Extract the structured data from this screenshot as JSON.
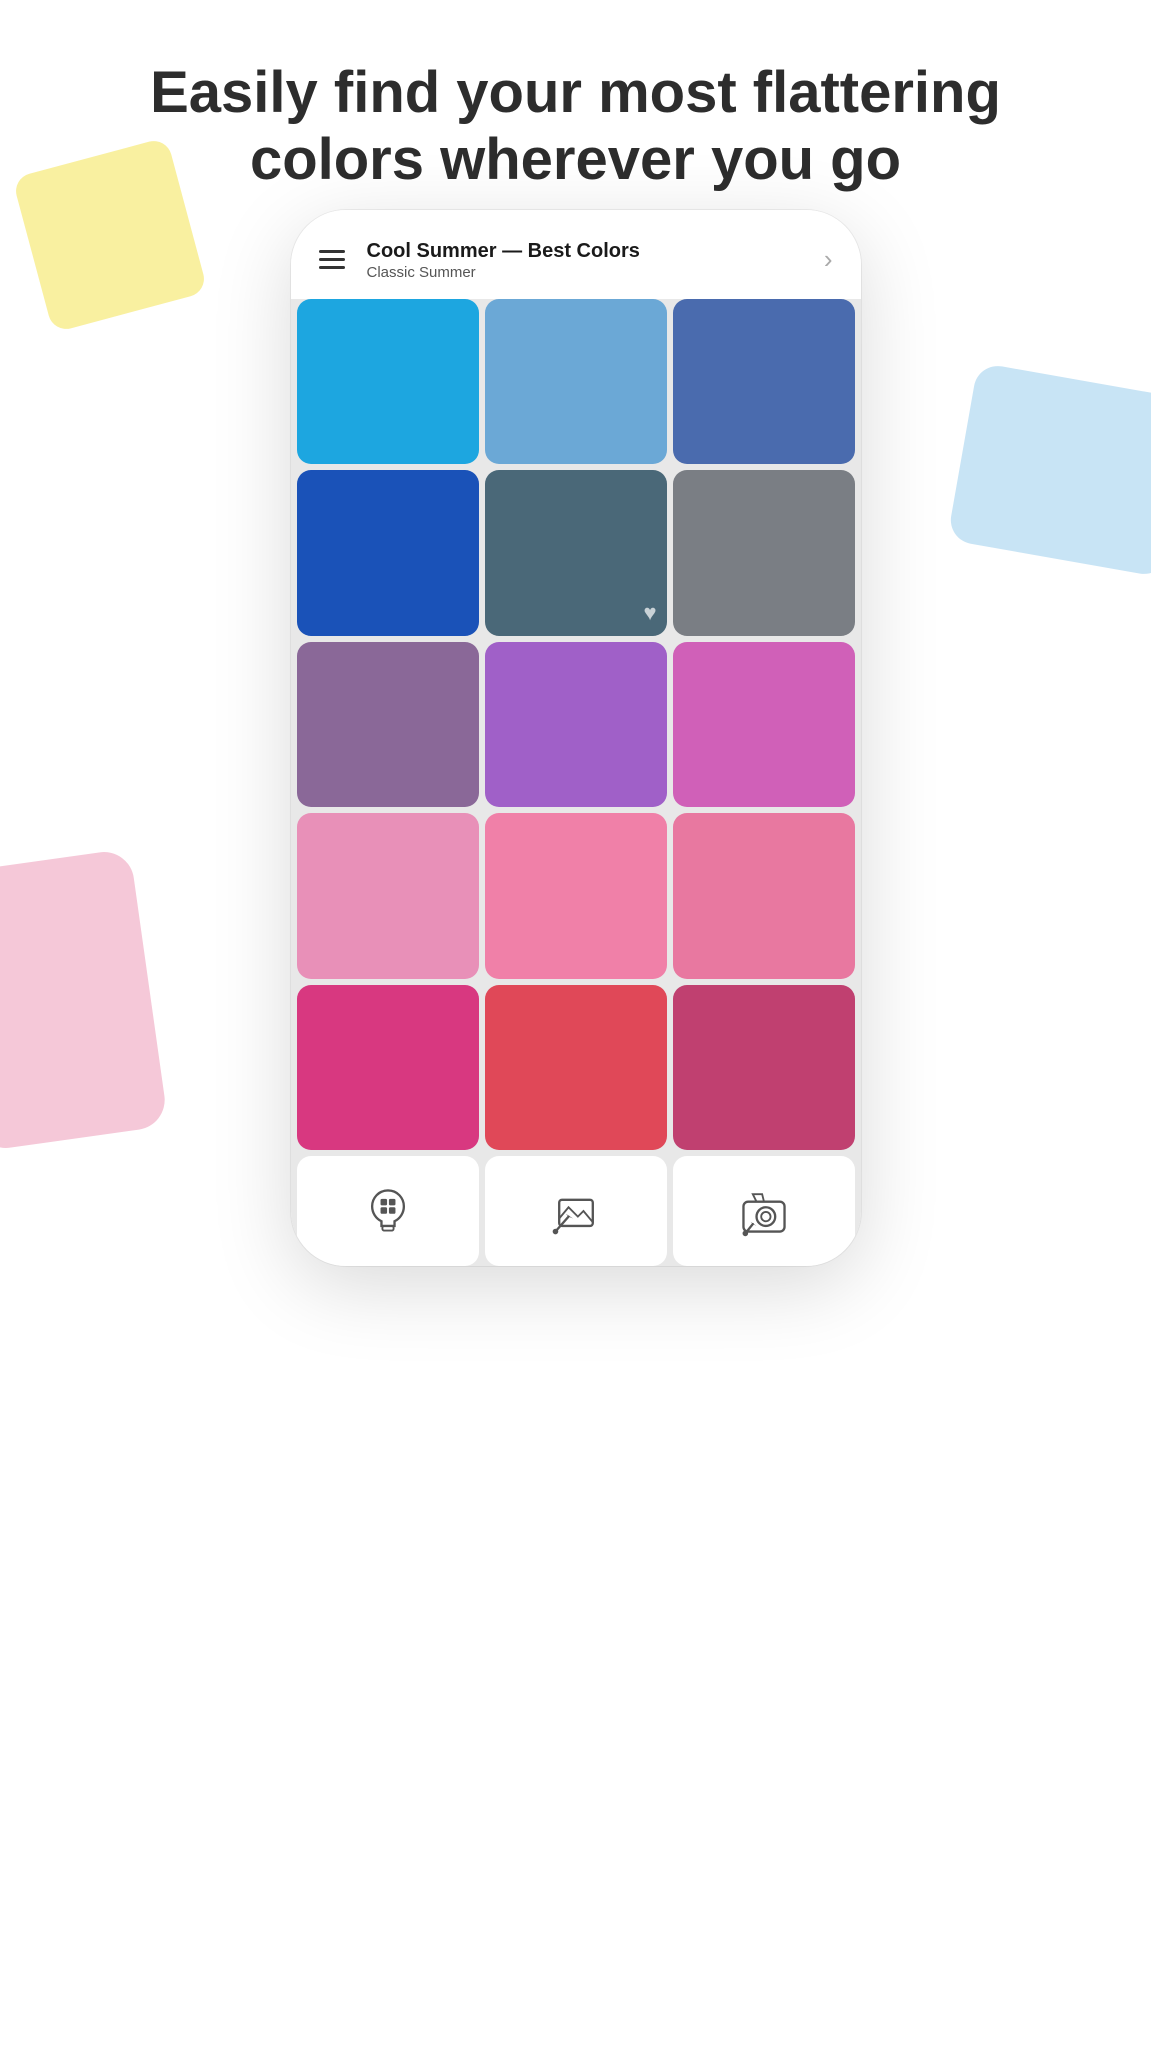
{
  "heading": {
    "line1": "Easily find your most flattering",
    "line2": "colors wherever you go"
  },
  "phone": {
    "header": {
      "title": "Cool Summer — Best Colors",
      "subtitle": "Classic Summer",
      "chevron": "›"
    },
    "colors": [
      {
        "id": "c1",
        "class": "c1",
        "name": "bright-blue",
        "hasHeart": false
      },
      {
        "id": "c2",
        "class": "c2",
        "name": "periwinkle-blue",
        "hasHeart": false
      },
      {
        "id": "c3",
        "class": "c3",
        "name": "slate-blue",
        "hasHeart": false
      },
      {
        "id": "c4",
        "class": "c4",
        "name": "royal-blue",
        "hasHeart": false
      },
      {
        "id": "c5",
        "class": "c5",
        "name": "steel-teal",
        "hasHeart": true
      },
      {
        "id": "c6",
        "class": "c6",
        "name": "warm-gray",
        "hasHeart": false
      },
      {
        "id": "c7",
        "class": "c7",
        "name": "muted-purple",
        "hasHeart": false
      },
      {
        "id": "c8",
        "class": "c8",
        "name": "medium-purple",
        "hasHeart": false
      },
      {
        "id": "c9",
        "class": "c9",
        "name": "bright-pink-purple",
        "hasHeart": false
      },
      {
        "id": "c10",
        "class": "c10",
        "name": "light-pink",
        "hasHeart": false
      },
      {
        "id": "c11",
        "class": "c11",
        "name": "medium-pink",
        "hasHeart": false
      },
      {
        "id": "c12",
        "class": "c12",
        "name": "hot-pink",
        "hasHeart": false
      },
      {
        "id": "c13",
        "class": "c13",
        "name": "deep-rose",
        "hasHeart": false
      },
      {
        "id": "c14",
        "class": "c14",
        "name": "coral-red",
        "hasHeart": false
      },
      {
        "id": "c15",
        "class": "c15",
        "name": "dark-pink",
        "hasHeart": false
      }
    ],
    "toolbar": {
      "btn1": {
        "name": "color-analysis-button",
        "label": "Color Analysis"
      },
      "btn2": {
        "name": "image-picker-button",
        "label": "Image Picker"
      },
      "btn3": {
        "name": "camera-picker-button",
        "label": "Camera Picker"
      }
    }
  },
  "decorative": {
    "yellow_shape": "sticky note yellow",
    "blue_shape": "light blue parallelogram",
    "pink_shape": "soft pink rectangle"
  }
}
